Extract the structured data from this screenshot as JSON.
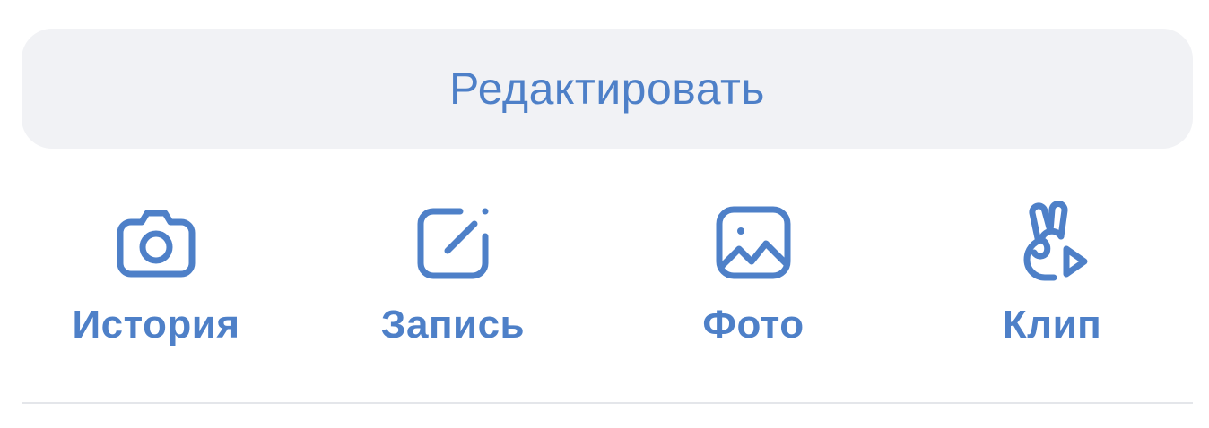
{
  "edit_button": {
    "label": "Редактировать"
  },
  "actions": [
    {
      "label": "История",
      "icon": "camera-icon"
    },
    {
      "label": "Запись",
      "icon": "compose-icon"
    },
    {
      "label": "Фото",
      "icon": "photo-icon"
    },
    {
      "label": "Клип",
      "icon": "clip-icon"
    }
  ],
  "colors": {
    "accent": "#4e80c8",
    "button_bg": "#f1f2f5",
    "divider": "#e4e6ea"
  }
}
